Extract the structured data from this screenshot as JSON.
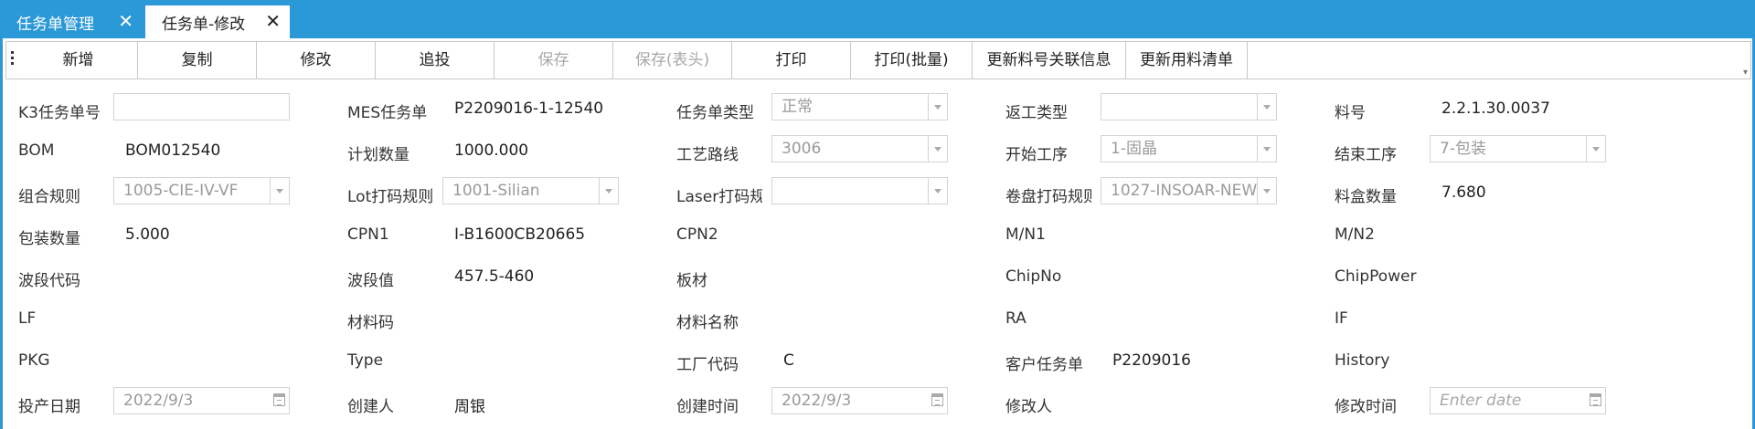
{
  "tabs": [
    {
      "label": "任务单管理",
      "close": "✕"
    },
    {
      "label": "任务单-修改",
      "close": "✕"
    }
  ],
  "toolbar": {
    "add": "新增",
    "copy": "复制",
    "modify": "修改",
    "append": "追投",
    "save": "保存",
    "save_header": "保存(表头)",
    "print": "打印",
    "print_batch": "打印(批量)",
    "update_material_link": "更新料号关联信息",
    "update_bom_list": "更新用料清单"
  },
  "form": {
    "k3_order_no": {
      "label": "K3任务单号",
      "value": ""
    },
    "mes_order_no": {
      "label": "MES任务单",
      "value": "P2209016-1-12540"
    },
    "order_type": {
      "label": "任务单类型",
      "value": "正常"
    },
    "rework_type": {
      "label": "返工类型",
      "value": ""
    },
    "part_no": {
      "label": "料号",
      "value": "2.2.1.30.0037"
    },
    "bom": {
      "label": "BOM",
      "value": "BOM012540"
    },
    "plan_qty": {
      "label": "计划数量",
      "value": "1000.000"
    },
    "process_route": {
      "label": "工艺路线",
      "value": "3006"
    },
    "start_process": {
      "label": "开始工序",
      "value": "1-固晶"
    },
    "end_process": {
      "label": "结束工序",
      "value": "7-包装"
    },
    "combo_rule": {
      "label": "组合规则",
      "value": "1005-CIE-IV-VF"
    },
    "lot_print_rule": {
      "label": "Lot打码规则",
      "value": "1001-Silian"
    },
    "laser_print_rule": {
      "label": "Laser打码规则",
      "value": ""
    },
    "reel_print_rule": {
      "label": "卷盘打码规则",
      "value": "1027-INSOAR-NEW"
    },
    "box_qty": {
      "label": "料盒数量",
      "value": "7.680"
    },
    "pack_qty": {
      "label": "包装数量",
      "value": "5.000"
    },
    "cpn1": {
      "label": "CPN1",
      "value": "I-B1600CB20665"
    },
    "cpn2": {
      "label": "CPN2",
      "value": ""
    },
    "mn1": {
      "label": "M/N1",
      "value": ""
    },
    "mn2": {
      "label": "M/N2",
      "value": ""
    },
    "band_code": {
      "label": "波段代码",
      "value": ""
    },
    "band_value": {
      "label": "波段值",
      "value": "457.5-460"
    },
    "board": {
      "label": "板材",
      "value": ""
    },
    "chip_no": {
      "label": "ChipNo",
      "value": ""
    },
    "chip_power": {
      "label": "ChipPower",
      "value": ""
    },
    "lf": {
      "label": "LF",
      "value": ""
    },
    "material_code": {
      "label": "材料码",
      "value": ""
    },
    "material_name": {
      "label": "材料名称",
      "value": ""
    },
    "ra": {
      "label": "RA",
      "value": ""
    },
    "if": {
      "label": "IF",
      "value": ""
    },
    "pkg": {
      "label": "PKG",
      "value": ""
    },
    "type": {
      "label": "Type",
      "value": ""
    },
    "factory_code": {
      "label": "工厂代码",
      "value": "C"
    },
    "customer_order": {
      "label": "客户任务单",
      "value": "P2209016"
    },
    "history": {
      "label": "History",
      "value": ""
    },
    "start_date": {
      "label": "投产日期",
      "value": "2022/9/3"
    },
    "creator": {
      "label": "创建人",
      "value": "周银"
    },
    "create_time": {
      "label": "创建时间",
      "value": "2022/9/3"
    },
    "modifier": {
      "label": "修改人",
      "value": ""
    },
    "modify_time": {
      "label": "修改时间",
      "value": "",
      "placeholder": "Enter date"
    }
  },
  "colors": {
    "accent": "#2b98d8",
    "border": "#d3d3d3",
    "disabled_text": "#a8a8a8"
  }
}
